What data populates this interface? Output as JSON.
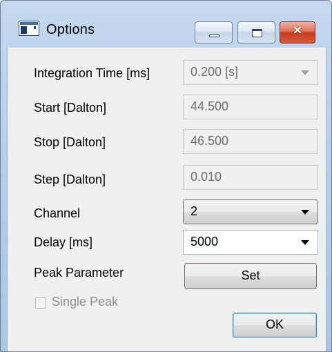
{
  "window": {
    "title": "Options",
    "buttons": {
      "minimize": "minimize",
      "maximize": "maximize",
      "close": "×"
    }
  },
  "form": {
    "integration_time": {
      "label": "Integration Time [ms]",
      "value": "0.200 [s]",
      "enabled": false
    },
    "start": {
      "label": "Start [Dalton]",
      "value": "44.500",
      "enabled": false
    },
    "stop": {
      "label": "Stop [Dalton]",
      "value": "46.500",
      "enabled": false
    },
    "step": {
      "label": "Step [Dalton]",
      "value": "0.010",
      "enabled": false
    },
    "channel": {
      "label": "Channel",
      "value": "2",
      "enabled": true
    },
    "delay": {
      "label": "Delay [ms]",
      "value": "5000",
      "enabled": true
    },
    "peak_parameter": {
      "label": "Peak Parameter",
      "button_label": "Set"
    },
    "single_peak": {
      "label": "Single Peak",
      "checked": false,
      "enabled": false
    }
  },
  "footer": {
    "ok_label": "OK"
  },
  "colors": {
    "frame": "#b9d1ec",
    "client": "#f0f0f0",
    "disabled_text": "#6d6d6d",
    "close_button": "#c8391d"
  }
}
